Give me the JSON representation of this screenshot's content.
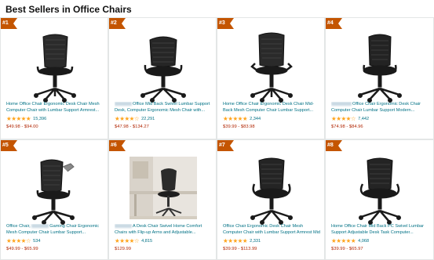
{
  "heading": "Best Sellers in Office Chairs",
  "products": [
    {
      "rank": "#1",
      "name": "Home Office Chair Ergonomic Desk Chair Mesh Computer Chair with Lumbar Support Armrest...",
      "stars": "★★★★★",
      "rating_count": "15,396",
      "price": "$49.98 - $94.00"
    },
    {
      "rank": "#2",
      "name": "Office Mid Back Swivel Lumbar Support Desk, Computer Ergonomic Mesh Chair with...",
      "stars": "★★★★☆",
      "rating_count": "22,291",
      "price": "$47.98 - $134.27"
    },
    {
      "rank": "#3",
      "name": "Home Office Chair Ergonomic Desk Chair Mid-Back Mesh Computer Chair Lumbar Support...",
      "stars": "★★★★★",
      "rating_count": "2,344",
      "price": "$39.99 - $83.98"
    },
    {
      "rank": "#4",
      "name": "Office Chair Ergonomic Desk Chair Computer Chair Lumbar Support Modern...",
      "stars": "★★★★☆",
      "rating_count": "7,442",
      "price": "$74.98 - $84.96"
    },
    {
      "rank": "#5",
      "name": "Gaming Chair Ergonomic Mesh Computer Chair Lumbar Support...",
      "prefix": "Office Chair,",
      "stars": "★★★★☆",
      "rating_count": "534",
      "price": "$49.99 - $65.99"
    },
    {
      "rank": "#6",
      "name": "A Desk Chair Swivel Home Comfort Chairs with Flip-up Arms and Adjustable...",
      "stars": "★★★★☆",
      "rating_count": "4,815",
      "price": "$129.99"
    },
    {
      "rank": "#7",
      "name": "Office Chair Ergonomic Desk Chair Mesh Computer Chair with Lumbar Support Armrest Mid Back...",
      "stars": "★★★★★",
      "rating_count": "2,331",
      "price": "$39.99 - $113.99"
    },
    {
      "rank": "#8",
      "name": "Home Office Chair Mid Back PC Swivel Lumbar Support Adjustable Desk Task Computer...",
      "stars": "★★★★★",
      "rating_count": "4,068",
      "price": "$39.99 - $65.97"
    }
  ]
}
